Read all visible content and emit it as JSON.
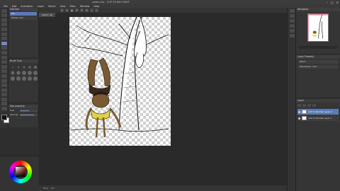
{
  "window": {
    "title": "saiten.clip - CLIP STUDIO PAINT",
    "minimize": "–",
    "maximize": "□",
    "close": "✕"
  },
  "menu": [
    "File",
    "Edit",
    "Animation",
    "Layer",
    "Select",
    "View",
    "Filter",
    "Window",
    "Help"
  ],
  "toolbar": {
    "icons": [
      "new-icon",
      "open-icon",
      "save-icon",
      "undo-icon",
      "redo-icon",
      "clear-icon",
      "transform-icon",
      "deselect-icon"
    ]
  },
  "subtool": {
    "header": "Sub tool",
    "items": [
      {
        "label": "Ink"
      },
      {
        "label": "Marker pen"
      }
    ]
  },
  "brush_size": {
    "header": "Brush Size"
  },
  "tool_property": {
    "header": "Tool property",
    "rows": [
      {
        "label": "Size",
        "fill": 0.55
      },
      {
        "label": "Opacity",
        "fill": 0.85
      }
    ]
  },
  "document": {
    "tab": "saiten.clip"
  },
  "status": {
    "zoom": "50.0",
    "angle": "0.0"
  },
  "navigator": {
    "header": "Navigator"
  },
  "layer_property": {
    "header": "Layer Property",
    "rows": [
      {
        "label": "Effect"
      },
      {
        "label": "Expression color"
      }
    ]
  },
  "layers": {
    "header": "Layer",
    "blend": "Normal",
    "opacity": "100 %",
    "items": [
      {
        "name": "100 % Normal Layer 2",
        "selected": true
      },
      {
        "name": "100 % Normal Layer 1",
        "selected": false
      }
    ]
  },
  "colors": {
    "accent": "#5b7bb4",
    "main": "#111111",
    "sub": "#ffffff"
  }
}
